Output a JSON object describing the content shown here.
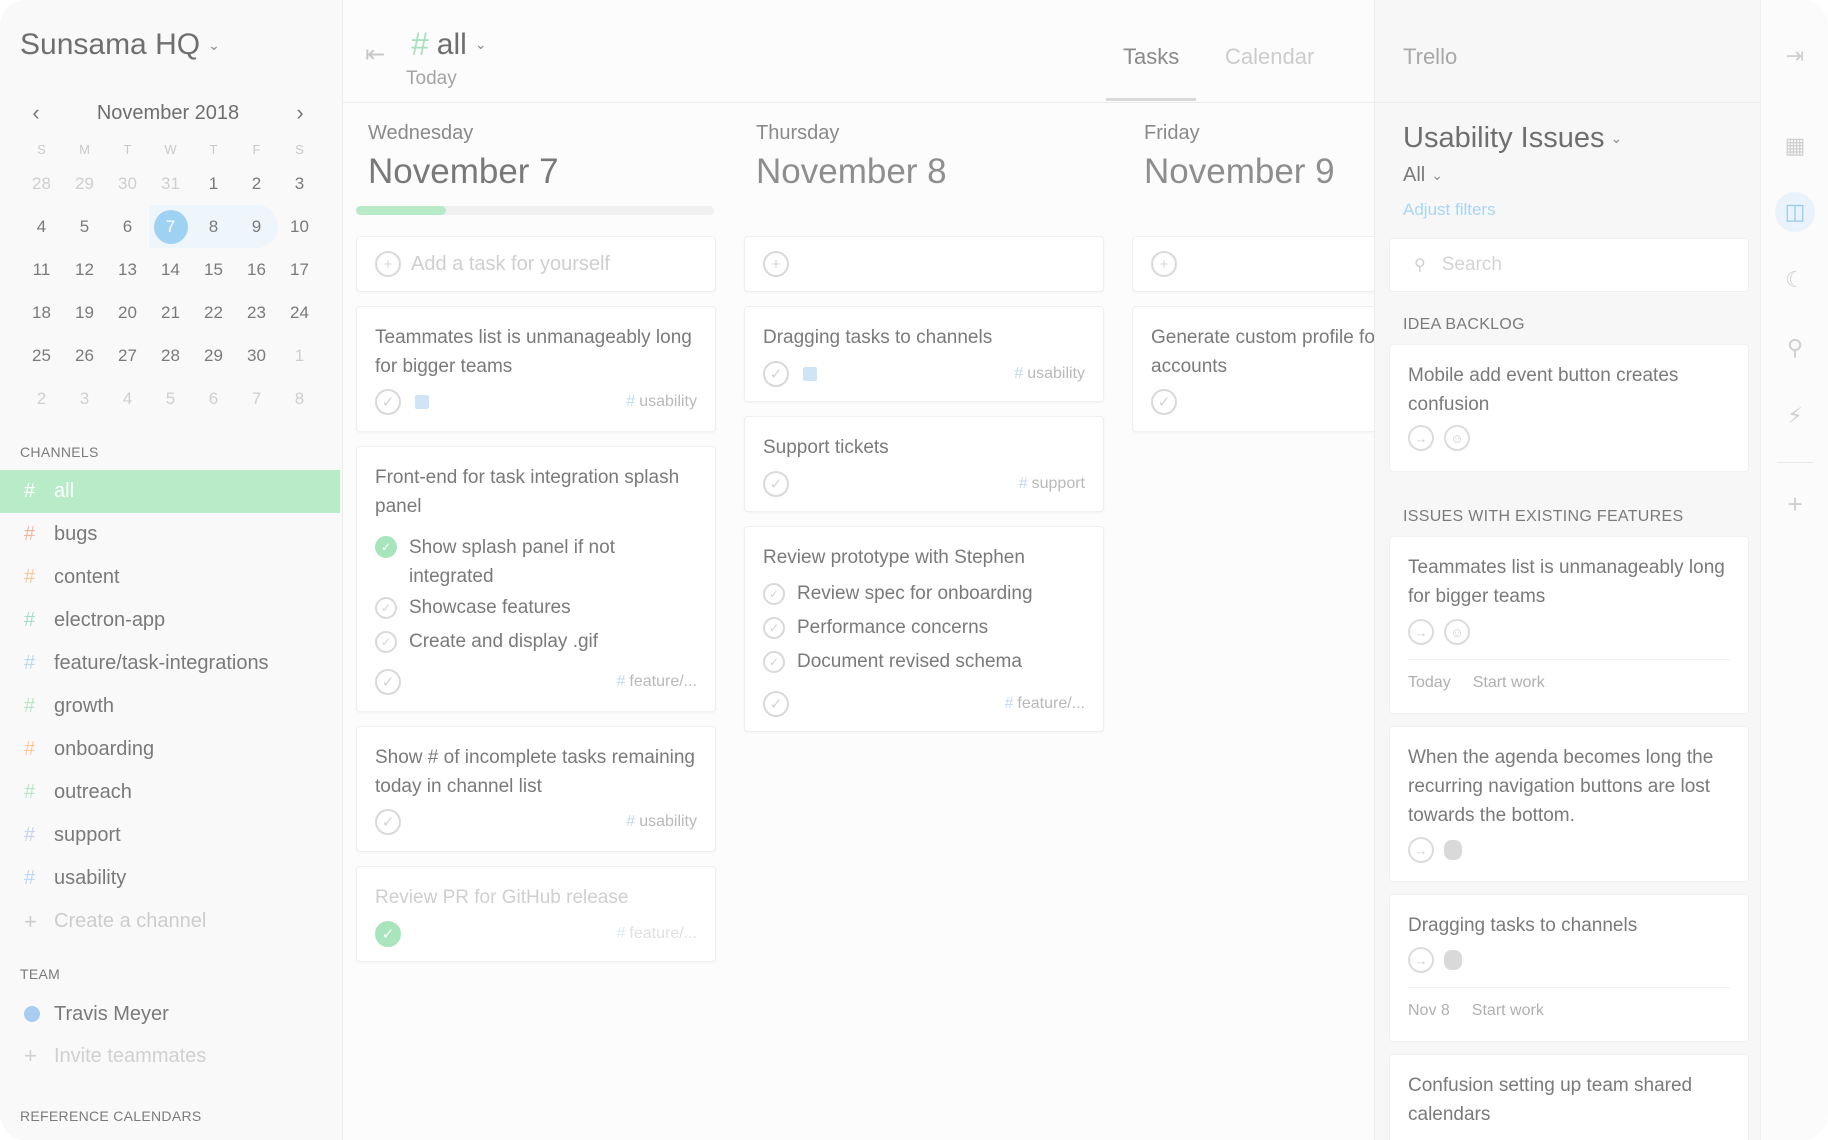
{
  "sidebar": {
    "workspace": "Sunsama HQ",
    "calendar": {
      "month_label": "November 2018",
      "dow": [
        "S",
        "M",
        "T",
        "W",
        "T",
        "F",
        "S"
      ],
      "weeks": [
        [
          "28",
          "29",
          "30",
          "31",
          "1",
          "2",
          "3"
        ],
        [
          "4",
          "5",
          "6",
          "7",
          "8",
          "9",
          "10"
        ],
        [
          "11",
          "12",
          "13",
          "14",
          "15",
          "16",
          "17"
        ],
        [
          "18",
          "19",
          "20",
          "21",
          "22",
          "23",
          "24"
        ],
        [
          "25",
          "26",
          "27",
          "28",
          "29",
          "30",
          "1"
        ],
        [
          "2",
          "3",
          "4",
          "5",
          "6",
          "7",
          "8"
        ]
      ],
      "selected": "7"
    },
    "channels_label": "CHANNELS",
    "channels": [
      {
        "name": "all",
        "color": "#ffffff",
        "active": true
      },
      {
        "name": "bugs",
        "color": "#f2b7a4"
      },
      {
        "name": "content",
        "color": "#f5c99c"
      },
      {
        "name": "electron-app",
        "color": "#a8dcc6"
      },
      {
        "name": "feature/task-integrations",
        "color": "#bcd9f2"
      },
      {
        "name": "growth",
        "color": "#b8e6c6"
      },
      {
        "name": "onboarding",
        "color": "#f6c9a0"
      },
      {
        "name": "outreach",
        "color": "#b8e6c6"
      },
      {
        "name": "support",
        "color": "#c9d3f0"
      },
      {
        "name": "usability",
        "color": "#bcd9f2"
      }
    ],
    "create_channel": "Create a channel",
    "team_label": "TEAM",
    "team_member": "Travis Meyer",
    "invite": "Invite teammates",
    "ref_cal_label": "REFERENCE CALENDARS"
  },
  "main": {
    "channel_title": "all",
    "channel_sub": "Today",
    "tabs": {
      "tasks": "Tasks",
      "calendar": "Calendar"
    },
    "add_placeholder": "Add a task for yourself",
    "days": [
      {
        "day": "Wednesday",
        "date": "November 7",
        "tasks": [
          {
            "title": "Teammates list is unmanageably long for bigger teams",
            "tag": "usability"
          },
          {
            "title": "Front-end for task integration splash panel",
            "tag": "feature/...",
            "subtasks": [
              {
                "label": "Show splash panel if not integrated",
                "done": true
              },
              {
                "label": "Showcase features"
              },
              {
                "label": "Create and display .gif"
              }
            ]
          },
          {
            "title": "Show # of incomplete tasks remaining today in channel list",
            "tag": "usability"
          },
          {
            "title": "Review PR for GitHub release",
            "tag": "feature/...",
            "done": true
          }
        ]
      },
      {
        "day": "Thursday",
        "date": "November 8",
        "tasks": [
          {
            "title": "Dragging tasks to channels",
            "tag": "usability"
          },
          {
            "title": "Support tickets",
            "tag": "support"
          },
          {
            "title": "Review prototype with Stephen",
            "tag": "feature/...",
            "subtasks": [
              {
                "label": "Review spec for onboarding"
              },
              {
                "label": "Performance concerns"
              },
              {
                "label": "Document revised schema"
              }
            ]
          }
        ]
      },
      {
        "day": "Friday",
        "date": "November 9",
        "tasks": [
          {
            "title": "Generate custom profile for new accounts"
          }
        ]
      }
    ]
  },
  "panel": {
    "name": "Trello",
    "board_title": "Usability Issues",
    "filter": "All",
    "adjust_filters": "Adjust filters",
    "search_placeholder": "Search",
    "lists": [
      {
        "name": "IDEA BACKLOG",
        "cards": [
          {
            "title": "Mobile add event button creates confusion"
          }
        ]
      },
      {
        "name": "ISSUES WITH EXISTING FEATURES",
        "cards": [
          {
            "title": "Teammates list is unmanageably long for bigger teams",
            "when": "Today",
            "action": "Start work"
          },
          {
            "title": "When the agenda becomes long the recurring navigation buttons are lost towards the bottom."
          },
          {
            "title": "Dragging tasks to channels",
            "when": "Nov 8",
            "action": "Start work"
          },
          {
            "title": "Confusion setting up team shared calendars"
          }
        ]
      }
    ]
  },
  "colors": {
    "accent_green": "#b8ecc9",
    "accent_blue": "#9fd2f2"
  }
}
